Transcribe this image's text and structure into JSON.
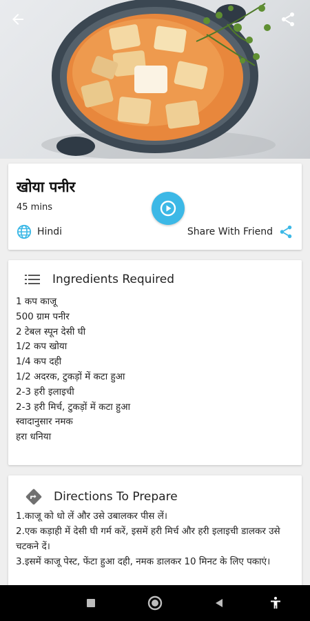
{
  "recipe": {
    "title": "खोया पनीर",
    "time": "45 mins",
    "language": "Hindi",
    "share_label": "Share With Friend"
  },
  "ingredients": {
    "heading": "Ingredients Required",
    "items": [
      "1 कप काजू",
      "500 ग्राम पनीर",
      "2 टेबल स्पून देसी घी",
      "1/2 कप खोया",
      "1/4 कप दही",
      "1/2 अदरक, टुकड़ों में कटा हुआ",
      "2-3 हरी इलाइची",
      "2-3 हरी मिर्च, टुकड़ों में कटा हुआ",
      "स्वादानुसार नमक",
      "हरा धनिया"
    ]
  },
  "directions": {
    "heading": "Directions To Prepare",
    "steps": [
      "1.काजू को धो लें और उसे उबालकर पीस लें।",
      "2.एक कड़ाही में देसी घी गर्म करें, इसमें हरी मिर्च और हरी इलाइची डालकर उसे चटकने दें।",
      "3.इसमें काजू पेस्ट, फेंटा हुआ दही, नमक डालकर 10 मिनट के लिए पकाएं।"
    ]
  },
  "colors": {
    "accent": "#3cb8e6",
    "navbar": "#000000",
    "card": "#ffffff",
    "background": "#efefef"
  },
  "icons": {
    "back": "arrow-left-icon",
    "share_top": "share-icon",
    "play": "play-circle-icon",
    "globe": "globe-icon",
    "share_friend": "share-icon",
    "ingredients": "list-icon",
    "directions": "direction-sign-icon",
    "nav_recents": "square-icon",
    "nav_home": "circle-icon",
    "nav_back": "triangle-back-icon",
    "nav_accessibility": "accessibility-icon"
  }
}
